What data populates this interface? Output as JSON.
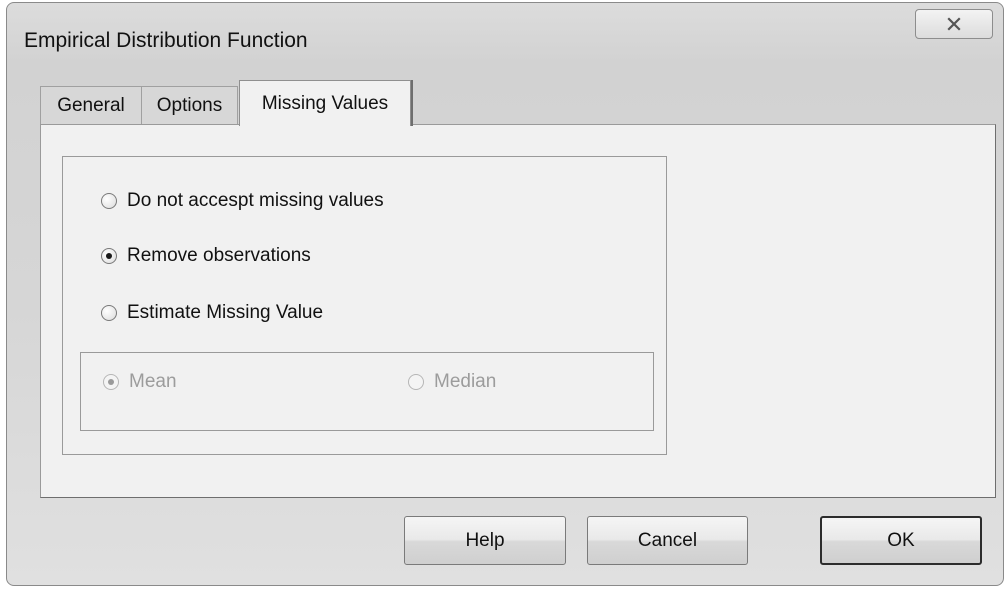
{
  "window": {
    "title": "Empirical Distribution Function"
  },
  "titlebar": {
    "close_icon": "close-icon"
  },
  "tabs": [
    {
      "label": "General",
      "active": false
    },
    {
      "label": "Options",
      "active": false
    },
    {
      "label": "Missing Values",
      "active": true
    }
  ],
  "missing_values": {
    "options": [
      {
        "label": "Do not accespt missing values",
        "checked": false
      },
      {
        "label": "Remove observations",
        "checked": true
      },
      {
        "label": "Estimate Missing Value",
        "checked": false
      }
    ],
    "estimate_methods": [
      {
        "label": "Mean",
        "checked": true,
        "enabled": false
      },
      {
        "label": "Median",
        "checked": false,
        "enabled": false
      }
    ]
  },
  "buttons": {
    "help": "Help",
    "cancel": "Cancel",
    "ok": "OK"
  }
}
